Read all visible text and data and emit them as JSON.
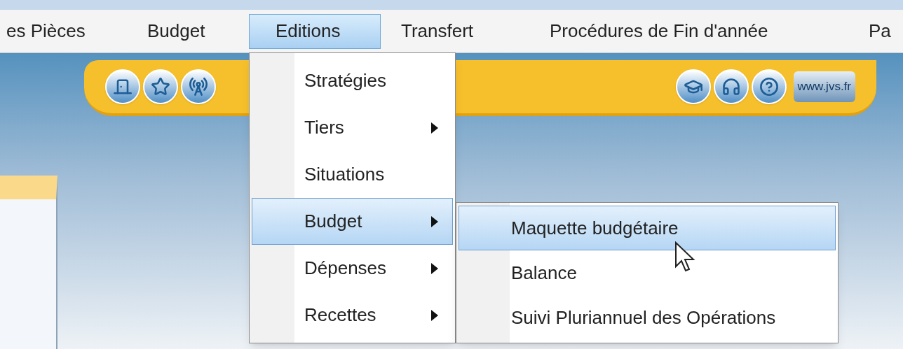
{
  "menu_bar": {
    "items": [
      {
        "label": "es Pièces",
        "selected": false
      },
      {
        "label": "Budget",
        "selected": false
      },
      {
        "label": "Editions",
        "selected": true
      },
      {
        "label": "Transfert",
        "selected": false
      },
      {
        "label": "Procédures de Fin d'année",
        "selected": false
      },
      {
        "label": "Pa",
        "selected": false
      }
    ]
  },
  "toolbar": {
    "link_badge": "www.jvs.fr"
  },
  "dropdown": {
    "items": [
      {
        "label": "Stratégies",
        "has_submenu": false,
        "selected": false
      },
      {
        "label": "Tiers",
        "has_submenu": true,
        "selected": false
      },
      {
        "label": "Situations",
        "has_submenu": false,
        "selected": false
      },
      {
        "label": "Budget",
        "has_submenu": true,
        "selected": true
      },
      {
        "label": "Dépenses",
        "has_submenu": true,
        "selected": false
      },
      {
        "label": "Recettes",
        "has_submenu": true,
        "selected": false
      }
    ]
  },
  "submenu": {
    "items": [
      {
        "label": "Maquette budgétaire",
        "selected": true
      },
      {
        "label": "Balance",
        "selected": false
      },
      {
        "label": "Suivi Pluriannuel des Opérations",
        "selected": false
      }
    ]
  }
}
